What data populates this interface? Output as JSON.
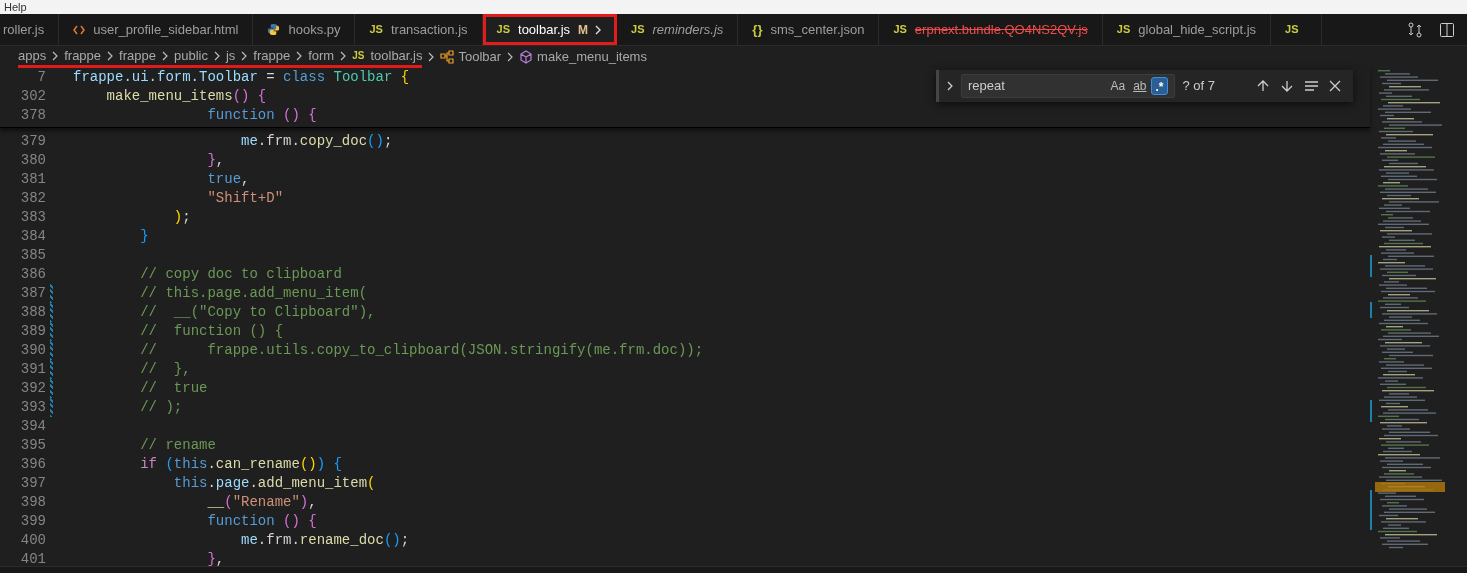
{
  "menu_bar": {
    "items": [
      "Help"
    ]
  },
  "tabs": [
    {
      "label": "roller.js",
      "kind": "none",
      "selected": false,
      "preview": false,
      "deleted": false,
      "annotated": false
    },
    {
      "label": "user_profile_sidebar.html",
      "kind": "html",
      "selected": false,
      "preview": false,
      "deleted": false,
      "annotated": false
    },
    {
      "label": "hooks.py",
      "kind": "python",
      "selected": false,
      "preview": false,
      "deleted": false,
      "annotated": false
    },
    {
      "label": "transaction.js",
      "kind": "js",
      "icon_text": "JS",
      "selected": false,
      "preview": false,
      "deleted": false,
      "annotated": false
    },
    {
      "label": "toolbar.js",
      "kind": "js",
      "icon_text": "JS",
      "badge": "M",
      "selected": true,
      "preview": false,
      "deleted": false,
      "annotated": true
    },
    {
      "label": "reminders.js",
      "kind": "js",
      "icon_text": "JS",
      "selected": false,
      "preview": true,
      "deleted": false,
      "annotated": false
    },
    {
      "label": "sms_center.json",
      "kind": "json",
      "icon_text": "{}",
      "selected": false,
      "preview": false,
      "deleted": false,
      "annotated": false
    },
    {
      "label": "erpnext.bundle.QO4NS2QV.js",
      "kind": "js",
      "icon_text": "JS",
      "selected": false,
      "preview": false,
      "deleted": true,
      "annotated": false
    },
    {
      "label": "global_hide_script.js",
      "kind": "js",
      "icon_text": "JS",
      "selected": false,
      "preview": false,
      "deleted": false,
      "annotated": false
    },
    {
      "kind": "js",
      "icon_text": "JS",
      "selected": false,
      "annotated": false
    }
  ],
  "breadcrumb": {
    "underlined": true,
    "items": [
      {
        "label": "apps",
        "kind": "folder"
      },
      {
        "label": "frappe",
        "kind": "folder"
      },
      {
        "label": "frappe",
        "kind": "folder"
      },
      {
        "label": "public",
        "kind": "folder"
      },
      {
        "label": "js",
        "kind": "folder"
      },
      {
        "label": "frappe",
        "kind": "folder"
      },
      {
        "label": "form",
        "kind": "folder"
      },
      {
        "label": "toolbar.js",
        "kind": "file",
        "icon_text": "JS"
      },
      {
        "label": "Toolbar",
        "kind": "class"
      },
      {
        "label": "make_menu_items",
        "kind": "method"
      }
    ]
  },
  "find_widget": {
    "value": "repeat",
    "match_case": false,
    "whole_word": false,
    "regex": true,
    "result": "? of 7",
    "toggles": [
      "Aa",
      "ab",
      ".*"
    ]
  },
  "sticky_lines": [
    {
      "number": "7",
      "tokens": [
        {
          "t": "frappe.ui.form.Toolbar",
          "kind": "var"
        },
        {
          "t": " = ",
          "kind": "punct"
        },
        {
          "t": "class",
          "kind": "kw"
        },
        {
          "t": " Toolbar",
          "kind": "type"
        },
        {
          "t": " {",
          "kind": "b1"
        }
      ]
    },
    {
      "number": "302",
      "tokens": [
        {
          "t": "    make_menu_items",
          "kind": "fn"
        },
        {
          "t": "()",
          "kind": "b2"
        },
        {
          "t": " {",
          "kind": "b2"
        }
      ]
    },
    {
      "number": "378",
      "tokens": [
        {
          "t": "                function",
          "kind": "kw"
        },
        {
          "t": " () {",
          "kind": "b2"
        }
      ]
    }
  ],
  "lines": [
    {
      "number": "379",
      "changed": false,
      "tokens": [
        {
          "t": "                    me",
          "kind": "var"
        },
        {
          "t": ".frm.",
          "kind": "punct"
        },
        {
          "t": "copy_doc",
          "kind": "fn"
        },
        {
          "t": "()",
          "kind": "b3"
        },
        {
          "t": ";",
          "kind": "punct"
        }
      ]
    },
    {
      "number": "380",
      "changed": false,
      "tokens": [
        {
          "t": "                }",
          "kind": "b2"
        },
        {
          "t": ",",
          "kind": "punct"
        }
      ]
    },
    {
      "number": "381",
      "changed": false,
      "tokens": [
        {
          "t": "                true",
          "kind": "kw"
        },
        {
          "t": ",",
          "kind": "punct"
        }
      ]
    },
    {
      "number": "382",
      "changed": false,
      "tokens": [
        {
          "t": "                \"Shift+D\"",
          "kind": "str"
        }
      ]
    },
    {
      "number": "383",
      "changed": false,
      "tokens": [
        {
          "t": "            )",
          "kind": "b1"
        },
        {
          "t": ";",
          "kind": "punct"
        }
      ]
    },
    {
      "number": "384",
      "changed": false,
      "tokens": [
        {
          "t": "        }",
          "kind": "b3"
        }
      ]
    },
    {
      "number": "385",
      "changed": false
    },
    {
      "number": "386",
      "changed": false,
      "tokens": [
        {
          "t": "        // copy doc to clipboard",
          "kind": "cmt"
        }
      ]
    },
    {
      "number": "387",
      "changed": true,
      "tokens": [
        {
          "t": "        // this.page.add_menu_item(",
          "kind": "cmt"
        }
      ]
    },
    {
      "number": "388",
      "changed": true,
      "tokens": [
        {
          "t": "        //  __(\"Copy to Clipboard\"),",
          "kind": "cmt"
        }
      ]
    },
    {
      "number": "389",
      "changed": true,
      "tokens": [
        {
          "t": "        //  function () {",
          "kind": "cmt"
        }
      ]
    },
    {
      "number": "390",
      "changed": true,
      "tokens": [
        {
          "t": "        //      frappe.utils.copy_to_clipboard(JSON.stringify(me.frm.doc));",
          "kind": "cmt"
        }
      ]
    },
    {
      "number": "391",
      "changed": true,
      "tokens": [
        {
          "t": "        //  },",
          "kind": "cmt"
        }
      ]
    },
    {
      "number": "392",
      "changed": true,
      "tokens": [
        {
          "t": "        //  true",
          "kind": "cmt"
        }
      ]
    },
    {
      "number": "393",
      "changed": true,
      "tokens": [
        {
          "t": "        // );",
          "kind": "cmt"
        }
      ]
    },
    {
      "number": "394",
      "changed": false
    },
    {
      "number": "395",
      "changed": false,
      "tokens": [
        {
          "t": "        // rename",
          "kind": "cmt"
        }
      ]
    },
    {
      "number": "396",
      "changed": false,
      "tokens": [
        {
          "t": "        if",
          "kind": "ctl"
        },
        {
          "t": " (",
          "kind": "b3"
        },
        {
          "t": "this",
          "kind": "kw"
        },
        {
          "t": ".",
          "kind": "punct"
        },
        {
          "t": "can_rename",
          "kind": "fn"
        },
        {
          "t": "()",
          "kind": "b1"
        },
        {
          "t": ")",
          "kind": "b3"
        },
        {
          "t": " {",
          "kind": "b3"
        }
      ]
    },
    {
      "number": "397",
      "changed": false,
      "tokens": [
        {
          "t": "            this",
          "kind": "kw"
        },
        {
          "t": ".",
          "kind": "punct"
        },
        {
          "t": "page",
          "kind": "var"
        },
        {
          "t": ".",
          "kind": "punct"
        },
        {
          "t": "add_menu_item",
          "kind": "fn"
        },
        {
          "t": "(",
          "kind": "b1"
        }
      ]
    },
    {
      "number": "398",
      "changed": false,
      "tokens": [
        {
          "t": "                __",
          "kind": "fn"
        },
        {
          "t": "(",
          "kind": "b2"
        },
        {
          "t": "\"Rename\"",
          "kind": "str"
        },
        {
          "t": ")",
          "kind": "b2"
        },
        {
          "t": ",",
          "kind": "punct"
        }
      ]
    },
    {
      "number": "399",
      "changed": false,
      "tokens": [
        {
          "t": "                function",
          "kind": "kw"
        },
        {
          "t": " () {",
          "kind": "b2"
        }
      ]
    },
    {
      "number": "400",
      "changed": false,
      "tokens": [
        {
          "t": "                    me",
          "kind": "var"
        },
        {
          "t": ".frm.",
          "kind": "punct"
        },
        {
          "t": "rename_doc",
          "kind": "fn"
        },
        {
          "t": "()",
          "kind": "b3"
        },
        {
          "t": ";",
          "kind": "punct"
        }
      ]
    },
    {
      "number": "401",
      "changed": false,
      "tokens": [
        {
          "t": "                }",
          "kind": "b2"
        },
        {
          "t": ",",
          "kind": "punct"
        }
      ]
    }
  ]
}
